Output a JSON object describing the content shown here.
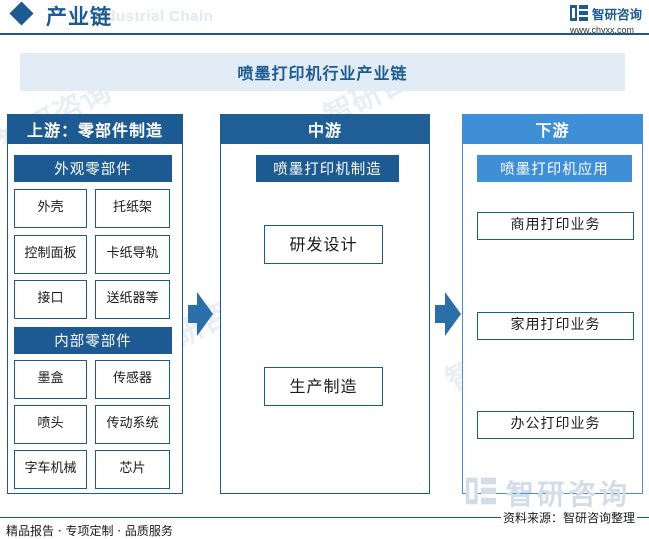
{
  "header": {
    "title": "产业链",
    "ghost_text": "Industrial Chain",
    "brand_name": "智研咨询",
    "brand_url": "www.chyxx.com"
  },
  "main_title": "喷墨打印机行业产业链",
  "upstream": {
    "heading": "上游：零部件制造",
    "external": {
      "label": "外观零部件",
      "items": [
        "外壳",
        "托纸架",
        "控制面板",
        "卡纸导轨",
        "接口",
        "送纸器等"
      ]
    },
    "internal": {
      "label": "内部零部件",
      "items": [
        "墨盒",
        "传感器",
        "喷头",
        "传动系统",
        "字车机械",
        "芯片"
      ]
    }
  },
  "midstream": {
    "heading": "中游",
    "section": "喷墨打印机制造",
    "items": [
      "研发设计",
      "生产制造"
    ]
  },
  "downstream": {
    "heading": "下游",
    "section": "喷墨打印机应用",
    "items": [
      "商用打印业务",
      "家用打印业务",
      "办公打印业务"
    ]
  },
  "watermark": "智研咨询",
  "footer": {
    "left": "精品报告 · 专项定制 · 品质服务",
    "right": "资料来源：智研咨询整理"
  },
  "colors": {
    "primary": "#1d5a92",
    "accent": "#3f8fd7",
    "title_band": "#e1ecf6"
  }
}
